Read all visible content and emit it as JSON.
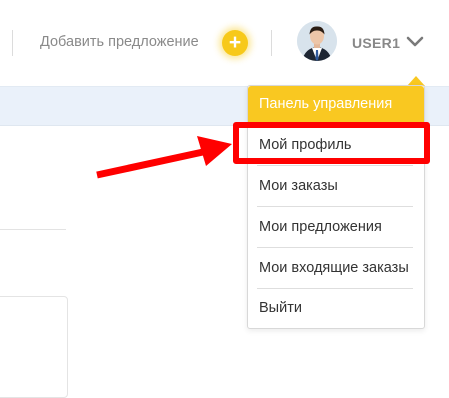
{
  "header": {
    "add_offer_label": "Добавить предложение",
    "add_offer_icon": "plus-icon",
    "user_name": "USER1",
    "avatar_icon": "avatar",
    "menu_toggle_icon": "chevron-down-icon"
  },
  "dropdown": {
    "head_label": "Панель управления",
    "items": [
      {
        "label": "Мой профиль"
      },
      {
        "label": "Мои заказы"
      },
      {
        "label": "Мои предложения"
      },
      {
        "label": "Мои входящие заказы"
      },
      {
        "label": "Выйти"
      }
    ]
  },
  "annotation": {
    "arrow_icon": "red-arrow-icon",
    "highlighted_item": "Мой профиль"
  },
  "colors": {
    "accent": "#f9c821",
    "annotation": "#ff0000",
    "info_strip": "#eaf1fa",
    "text": "#333333",
    "muted": "#8a8a8a"
  }
}
